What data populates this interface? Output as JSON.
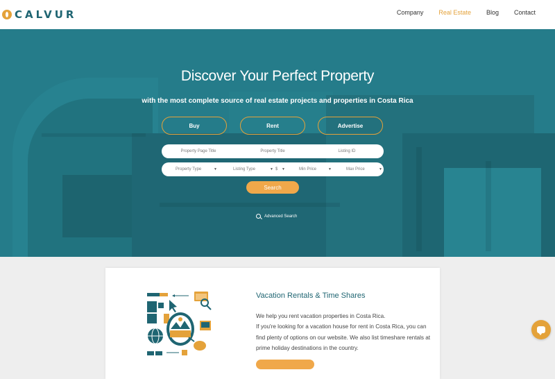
{
  "brand": {
    "name": "CALVUR",
    "accent": "#e4a23a",
    "primary": "#1f6572"
  },
  "nav": {
    "items": [
      {
        "label": "Company"
      },
      {
        "label": "Real Estate",
        "active": true
      },
      {
        "label": "Blog"
      },
      {
        "label": "Contact"
      }
    ]
  },
  "hero": {
    "title": "Discover Your Perfect Property",
    "subtitle": "with the most complete source of real estate projects and properties in Costa Rica",
    "tabs": [
      "Buy",
      "Rent",
      "Advertise"
    ],
    "fields": {
      "page_title_placeholder": "Property Page Title",
      "title_placeholder": "Property Title",
      "id_placeholder": "Listing ID",
      "type": "Property Type",
      "listing_type": "Listing Type",
      "currency": "$",
      "min_price": "Min Price",
      "max_price": "Max Price"
    },
    "search_label": "Search",
    "advanced_label": "Advanced Search"
  },
  "card": {
    "title": "Vacation Rentals & Time Shares",
    "line1": "We help you rent vacation properties in Costa Rica.",
    "line2": "If you're looking for a vacation house for rent in Costa Rica, you can find plenty of options on our website. We also list timeshare rentals at prime holiday destinations in the country."
  },
  "icons": {
    "logo": "calvur-logo-icon",
    "advanced": "search-icon",
    "chat": "chat-icon"
  }
}
